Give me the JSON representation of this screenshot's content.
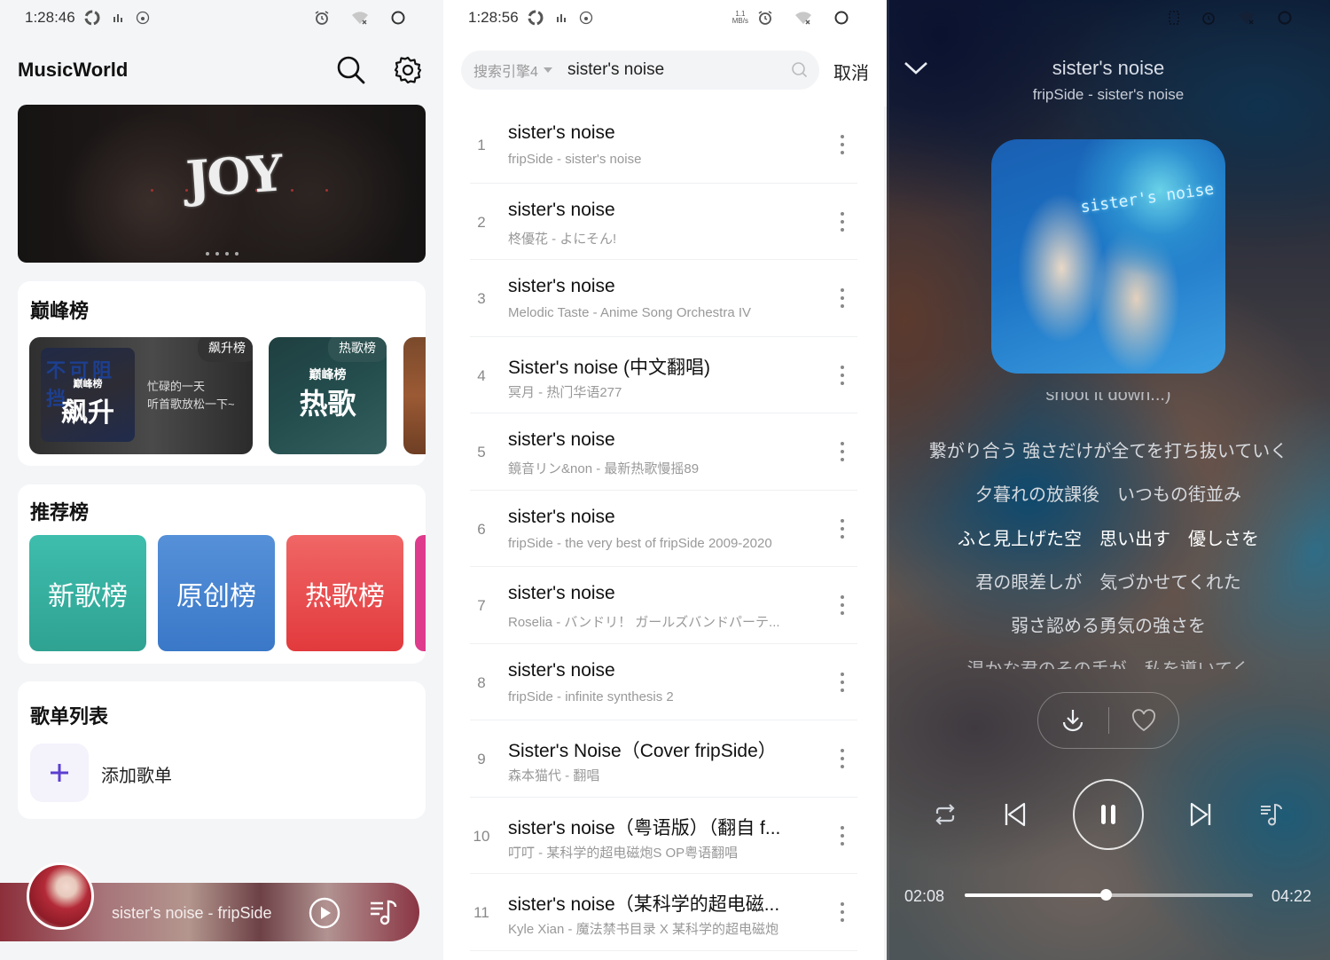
{
  "home": {
    "status": {
      "time": "1:28:46"
    },
    "app_title": "MusicWorld",
    "banner": {
      "title": "JOY",
      "slides": 4,
      "active_slide": 1
    },
    "peak": {
      "title": "巅峰榜",
      "items": [
        {
          "badge": "飙升榜",
          "cover_sub": "巅峰榜",
          "cover_main": "飙升",
          "cover_bg": "不可阻挡",
          "desc_line1": "忙碌的一天",
          "desc_line2": "听首歌放松一下~"
        },
        {
          "badge": "热歌榜",
          "cover_sub": "巅峰榜",
          "cover_main": "热歌"
        }
      ]
    },
    "recommend": {
      "title": "推荐榜",
      "tiles": [
        {
          "label": "新歌榜",
          "color": "#35b0a0"
        },
        {
          "label": "原创榜",
          "color": "#4a86d2"
        },
        {
          "label": "热歌榜",
          "color": "#ea4f51"
        }
      ]
    },
    "playlists": {
      "title": "歌单列表",
      "add_label": "添加歌单",
      "accent": "#5b3fd0"
    },
    "mini_player": {
      "now_playing": "sister's noise - fripSide",
      "state": "paused"
    }
  },
  "search": {
    "status": {
      "time": "1:28:56",
      "net_speed": "1.1",
      "net_unit": "MB/s"
    },
    "engine": "搜索引擎4",
    "query": "sister's noise",
    "cancel_label": "取消",
    "results": [
      {
        "n": "1",
        "title": "sister's noise",
        "sub": "fripSide - sister's noise"
      },
      {
        "n": "2",
        "title": "sister's noise",
        "sub": "柊優花 - よにそん!"
      },
      {
        "n": "3",
        "title": "sister's noise",
        "sub": "Melodic Taste - Anime Song Orchestra IV"
      },
      {
        "n": "4",
        "title": "Sister's noise (中文翻唱)",
        "sub": "冥月 - 热门华语277"
      },
      {
        "n": "5",
        "title": "sister's noise",
        "sub": "鏡音リン&non - 最新热歌慢摇89"
      },
      {
        "n": "6",
        "title": "sister's noise",
        "sub": "fripSide - the very best of fripSide 2009-2020"
      },
      {
        "n": "7",
        "title": "sister's noise",
        "sub": "Roselia - バンドリ！ ガールズバンドパーテ..."
      },
      {
        "n": "8",
        "title": "sister's noise",
        "sub": "fripSide - infinite synthesis 2"
      },
      {
        "n": "9",
        "title": "Sister's Noise（Cover fripSide）",
        "sub": "森本猫代 - 翻唱"
      },
      {
        "n": "10",
        "title": "sister's noise（粤语版）（翻自 f...",
        "sub": "叮叮 - 某科学的超电磁炮S OP粤语翻唱"
      },
      {
        "n": "11",
        "title": "sister's noise（某科学的超电磁...",
        "sub": "Kyle Xian - 魔法禁书目录 X 某科学的超电磁炮"
      }
    ]
  },
  "player": {
    "title": "sister's noise",
    "subtitle": "fripSide - sister's noise",
    "album_text": "sister's noise",
    "lyrics": [
      "shoot it down...)",
      "繋がり合う 強さだけが全てを打ち抜いていく",
      "夕暮れの放課後　いつもの街並み",
      "ふと見上げた空　思い出す　優しさを",
      "君の眼差しが　気づかせてくれた",
      "弱さ認める勇気の強さを",
      "温かな君のその手が　私を導いてく"
    ],
    "active_lyric": 3,
    "current_time": "02:08",
    "total_time": "04:22",
    "progress": 0.49,
    "state": "playing"
  }
}
